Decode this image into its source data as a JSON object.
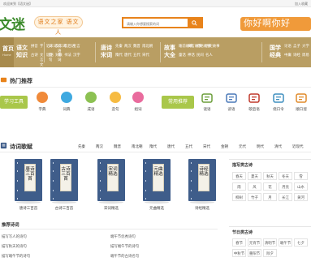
{
  "topbar": {
    "left_text": "欢迎来到【语文迷】",
    "right_text": "加入收藏"
  },
  "header": {
    "logo_text": "文迷",
    "slogan": "语文之家 语文人",
    "search_placeholder": "请输入你想要搜索的词",
    "hotline": "你好啊你好"
  },
  "nav": {
    "home_label": "首页",
    "home_sub": "Home",
    "blocks": [
      {
        "big": "语文\n知识",
        "items": [
          "拼音",
          "字",
          "词",
          "成语",
          "古诗",
          "文言文",
          "造句",
          "组词"
        ]
      },
      {
        "big": "",
        "items": [
          "近义词",
          "反义词",
          "歇后语",
          "名言",
          "谜语",
          "对联",
          "书法",
          "汉字"
        ]
      },
      {
        "big": "唐诗\n宋词",
        "items": [
          "先秦",
          "两汉",
          "魏晋",
          "南北朝",
          "隋代",
          "唐代",
          "五代",
          "宋代"
        ]
      },
      {
        "big": "故事\n大全",
        "items": [
          "睡前故事",
          "寓言故事",
          "成语故事",
          "历史故事",
          "童话",
          "神话",
          "民间",
          "名人"
        ]
      },
      {
        "big": "国学\n经典",
        "items": [
          "论语",
          "孟子",
          "大学",
          "中庸",
          "诗经",
          "周易"
        ]
      }
    ]
  },
  "hot": {
    "title": "热门推荐",
    "tools_button": "学习工具",
    "tools": [
      "字典",
      "词典",
      "成语",
      "造句",
      "组词"
    ],
    "common_button": "常用推荐",
    "common": [
      "谜语",
      "谚语",
      "歇后语",
      "绕口令",
      "顺口溜"
    ]
  },
  "poetry": {
    "title": "诗词歌赋",
    "dynasties": [
      "先秦",
      "两汉",
      "魏晋",
      "南北朝",
      "隋代",
      "唐代",
      "五代",
      "宋代",
      "金朝",
      "元代",
      "明代",
      "清代",
      "近现代"
    ],
    "books": [
      {
        "cover": "唐诗三百首",
        "label": "唐诗三百首"
      },
      {
        "cover": "古诗三百首",
        "label": "古诗三百首"
      },
      {
        "cover": "宋词精选",
        "label": "宋词精选"
      },
      {
        "cover": "元曲精选",
        "label": "元曲精选"
      },
      {
        "cover": "诗经精选",
        "label": "诗经精选"
      }
    ],
    "recommend_title": "推荐诗词",
    "recommend_left": [
      "描写写人的诗句",
      "描写秋天的诗句",
      "描写端午节的诗句"
    ],
    "recommend_right": [
      "端午节优秀诗句",
      "描写端午节的诗句",
      "端午节的古诗名句"
    ]
  },
  "side": {
    "scene_title": "描写类古诗",
    "scene_tags": [
      "春天",
      "夏天",
      "秋天",
      "冬天",
      "雪",
      "雨",
      "风",
      "花",
      "月亮",
      "山水",
      "柳树",
      "竹子",
      "月",
      "长江",
      "黄河"
    ],
    "festival_title": "节日类古诗",
    "festival_tags": [
      "春节",
      "元宵节",
      "清明节",
      "端午节",
      "七夕",
      "中秋节",
      "重阳节",
      "除夕"
    ]
  },
  "colors": {
    "brand_green": "#3a8a2a",
    "accent_orange": "#e8831b",
    "nav_tan": "#b99e63",
    "tool_green": "#a9c74a",
    "book_blue": "#3f5d8a"
  }
}
